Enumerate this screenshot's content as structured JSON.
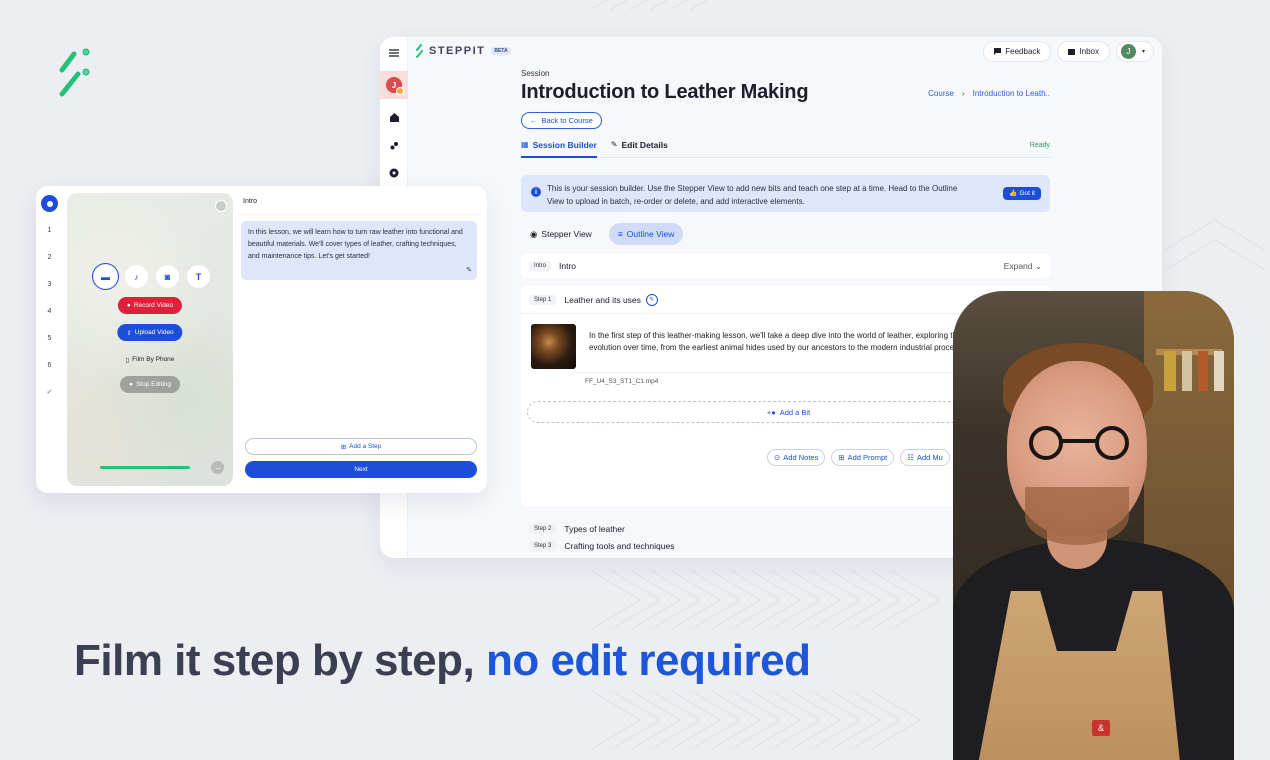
{
  "colors": {
    "accent": "#1d4ed8",
    "brand_green": "#22c27a",
    "record_red": "#e0203a",
    "ready_green": "#2a9d5c"
  },
  "brand": {
    "icon": "steppit-brand-icon"
  },
  "app": {
    "logo_text": "STEPPIT",
    "logo_badge": "BETA",
    "feedback_label": "Feedback",
    "inbox_label": "Inbox",
    "user_initial": "J",
    "rail_avatar_initial": "J",
    "rail_icons": [
      "menu-icon",
      "home-icon",
      "community-icon",
      "explore-icon"
    ],
    "session_label": "Session",
    "session_title": "Introduction to Leather Making",
    "breadcrumb": [
      "Course",
      "Introduction to Leath.."
    ],
    "back_label": "Back to Course",
    "tabs": [
      {
        "label": "Session Builder",
        "active": true
      },
      {
        "label": "Edit Details",
        "active": false
      }
    ],
    "status": "Ready",
    "info_text": "This is your session builder. Use the Stepper View to add new bits and teach one step at a time. Head to the Outline View to upload in batch, re-order or delete, and add interactive elements.",
    "got_it_label": "Got it",
    "views": [
      {
        "label": "Stepper View",
        "active": false
      },
      {
        "label": "Outline View",
        "active": true
      }
    ],
    "intro": {
      "tag": "Intro",
      "title": "Intro",
      "expand_label": "Expand"
    },
    "step1": {
      "tag": "Step 1",
      "title": "Leather and its uses",
      "bit_text": "In the first step of this leather-making lesson, we'll take a deep dive into the world of leather, exploring the history of leather and its evolution over time, from the earliest animal hides used by our ancestors to the modern industrial processes used today.",
      "bit_file": "FF_U4_S3_ST1_C1.mp4",
      "add_bit_label": "Add a Bit",
      "actions": [
        "Add Notes",
        "Add Prompt",
        "Add Mu"
      ]
    },
    "step2": {
      "tag": "Step 2",
      "title": "Types of leather"
    },
    "step3": {
      "tag": "Step 3",
      "title": "Crafting tools and techniques"
    }
  },
  "stepper": {
    "steps": [
      "1",
      "2",
      "3",
      "4",
      "5",
      "6"
    ],
    "done_icon": "check-icon",
    "media_icons": [
      "video-icon",
      "mic-icon",
      "camera-icon",
      "text-icon"
    ],
    "record_label": "Record Video",
    "upload_label": "Upload Video",
    "phone_label": "Film By Phone",
    "stop_label": "Stop Editing",
    "pane_title": "Intro",
    "intro_text": "In this lesson, we will learn how to turn raw leather into functional and beautiful materials. We'll cover types of leather, crafting techniques, and maintenance tips. Let's get started!",
    "add_step_label": "Add a Step",
    "next_label": "Next"
  },
  "headline": {
    "plain": "Film it step by step, ",
    "accent": "no edit required"
  }
}
